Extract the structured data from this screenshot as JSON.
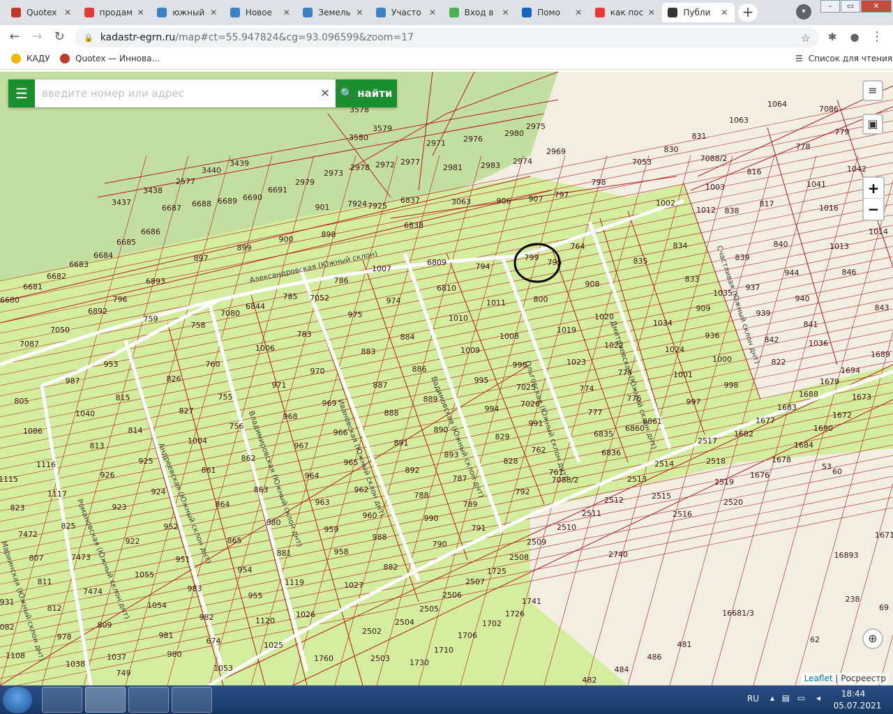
{
  "browser": {
    "tabs": [
      {
        "title": "Quotex",
        "color": "#c0392b",
        "active": false
      },
      {
        "title": "продам",
        "color": "#e53935",
        "active": false
      },
      {
        "title": "южный",
        "color": "#3b82c4",
        "active": false
      },
      {
        "title": "Новое",
        "color": "#3b82c4",
        "active": false
      },
      {
        "title": "Земель",
        "color": "#3b82c4",
        "active": false
      },
      {
        "title": "Участо",
        "color": "#3b82c4",
        "active": false
      },
      {
        "title": "Вход в",
        "color": "#4caf50",
        "active": false
      },
      {
        "title": "Помо",
        "color": "#1565c0",
        "active": false
      },
      {
        "title": "как пос",
        "color": "#e53935",
        "active": false
      },
      {
        "title": "Публи",
        "color": "#333333",
        "active": true
      }
    ],
    "url_host": "kadastr-egrn.ru",
    "url_path": "/map#ct=55.947824&cg=93.096599&zoom=17",
    "bookmarks": [
      {
        "label": "КАДУ",
        "color": "#f2b600"
      },
      {
        "label": "Quotex — Иннова...",
        "color": "#c0392b"
      }
    ],
    "reading_list": "Список для чтения"
  },
  "map": {
    "search_placeholder": "введите номер или адрес",
    "find_label": "найти",
    "zoom_in": "+",
    "zoom_out": "−",
    "attribution_leaflet": "Leaflet",
    "attribution_separator": " | ",
    "attribution_source": "Росреестр",
    "colors": {
      "background": "#f2eee2",
      "forest": "#c3dfa0",
      "plot_fill": "#d3ec9e",
      "boundary": "#b51a1a",
      "road": "#ffffff",
      "highlight_circle": "#000000",
      "search_green": "#1b8f2e"
    },
    "streets": [
      "Александровская (Южный склон)",
      "Дмитриевская (Южный склон днт)",
      "Ольговская (Южный склон днт)",
      "Вадимовская (Южный склон днт)",
      "Ивановская (Южный склон днт)",
      "Владимировская (Южный склон днт)",
      "Андреевская (Южный склон днт)",
      "Романовская (Южный склон днт)",
      "Мариинская (Южный склон днт)",
      "Счастливая (Южный склон днт)"
    ],
    "highlighted_plot": "799",
    "plots": [
      {
        "n": "3578"
      },
      {
        "n": "3579"
      },
      {
        "n": "3580"
      },
      {
        "n": "2971"
      },
      {
        "n": "2976"
      },
      {
        "n": "2980"
      },
      {
        "n": "2975"
      },
      {
        "n": "3440"
      },
      {
        "n": "3439"
      },
      {
        "n": "2577"
      },
      {
        "n": "3438"
      },
      {
        "n": "3437"
      },
      {
        "n": "2979"
      },
      {
        "n": "2973"
      },
      {
        "n": "2978"
      },
      {
        "n": "2972"
      },
      {
        "n": "2977"
      },
      {
        "n": "2981"
      },
      {
        "n": "2983"
      },
      {
        "n": "2974"
      },
      {
        "n": "2969"
      },
      {
        "n": "6687"
      },
      {
        "n": "6688"
      },
      {
        "n": "6689"
      },
      {
        "n": "6690"
      },
      {
        "n": "6691"
      },
      {
        "n": "6686"
      },
      {
        "n": "6685"
      },
      {
        "n": "6684"
      },
      {
        "n": "6683"
      },
      {
        "n": "6682"
      },
      {
        "n": "6681"
      },
      {
        "n": "6680"
      },
      {
        "n": "901"
      },
      {
        "n": "7924"
      },
      {
        "n": "7925"
      },
      {
        "n": "6837"
      },
      {
        "n": "6838"
      },
      {
        "n": "3063"
      },
      {
        "n": "906"
      },
      {
        "n": "907"
      },
      {
        "n": "797"
      },
      {
        "n": "798"
      },
      {
        "n": "7053"
      },
      {
        "n": "830"
      },
      {
        "n": "831"
      },
      {
        "n": "1063"
      },
      {
        "n": "1064"
      },
      {
        "n": "7086"
      },
      {
        "n": "7088/2"
      },
      {
        "n": "779"
      },
      {
        "n": "899"
      },
      {
        "n": "900"
      },
      {
        "n": "898"
      },
      {
        "n": "897"
      },
      {
        "n": "6893"
      },
      {
        "n": "6892"
      },
      {
        "n": "796"
      },
      {
        "n": "7050"
      },
      {
        "n": "7087"
      },
      {
        "n": "759"
      },
      {
        "n": "758"
      },
      {
        "n": "7080"
      },
      {
        "n": "6844"
      },
      {
        "n": "785"
      },
      {
        "n": "7052"
      },
      {
        "n": "786"
      },
      {
        "n": "1007"
      },
      {
        "n": "6809"
      },
      {
        "n": "794"
      },
      {
        "n": "799"
      },
      {
        "n": "795"
      },
      {
        "n": "764"
      },
      {
        "n": "1012"
      },
      {
        "n": "1002"
      },
      {
        "n": "834"
      },
      {
        "n": "835"
      },
      {
        "n": "833"
      },
      {
        "n": "1035"
      },
      {
        "n": "909"
      },
      {
        "n": "1034"
      },
      {
        "n": "936"
      },
      {
        "n": "1024"
      },
      {
        "n": "1000"
      },
      {
        "n": "1001"
      },
      {
        "n": "998"
      },
      {
        "n": "997"
      },
      {
        "n": "1003"
      },
      {
        "n": "816"
      },
      {
        "n": "838"
      },
      {
        "n": "817"
      },
      {
        "n": "839"
      },
      {
        "n": "840"
      },
      {
        "n": "937"
      },
      {
        "n": "944"
      },
      {
        "n": "939"
      },
      {
        "n": "940"
      },
      {
        "n": "842"
      },
      {
        "n": "841"
      },
      {
        "n": "822"
      },
      {
        "n": "1036"
      },
      {
        "n": "778"
      },
      {
        "n": "1041"
      },
      {
        "n": "1042"
      },
      {
        "n": "1016"
      },
      {
        "n": "1013"
      },
      {
        "n": "1014"
      },
      {
        "n": "846"
      },
      {
        "n": "843"
      },
      {
        "n": "6810"
      },
      {
        "n": "1011"
      },
      {
        "n": "1010"
      },
      {
        "n": "1008"
      },
      {
        "n": "1009"
      },
      {
        "n": "996"
      },
      {
        "n": "995"
      },
      {
        "n": "7025"
      },
      {
        "n": "7026"
      },
      {
        "n": "994"
      },
      {
        "n": "991"
      },
      {
        "n": "829"
      },
      {
        "n": "828"
      },
      {
        "n": "792"
      },
      {
        "n": "762"
      },
      {
        "n": "761"
      },
      {
        "n": "7088/2"
      },
      {
        "n": "800"
      },
      {
        "n": "908"
      },
      {
        "n": "1020"
      },
      {
        "n": "1019"
      },
      {
        "n": "1022"
      },
      {
        "n": "1023"
      },
      {
        "n": "775"
      },
      {
        "n": "774"
      },
      {
        "n": "776"
      },
      {
        "n": "777"
      },
      {
        "n": "6835"
      },
      {
        "n": "6860"
      },
      {
        "n": "6861"
      },
      {
        "n": "6836"
      },
      {
        "n": "974"
      },
      {
        "n": "975"
      },
      {
        "n": "884"
      },
      {
        "n": "883"
      },
      {
        "n": "886"
      },
      {
        "n": "887"
      },
      {
        "n": "889"
      },
      {
        "n": "888"
      },
      {
        "n": "890"
      },
      {
        "n": "891"
      },
      {
        "n": "893"
      },
      {
        "n": "892"
      },
      {
        "n": "787"
      },
      {
        "n": "788"
      },
      {
        "n": "789"
      },
      {
        "n": "990"
      },
      {
        "n": "791"
      },
      {
        "n": "790"
      },
      {
        "n": "1006"
      },
      {
        "n": "783"
      },
      {
        "n": "970"
      },
      {
        "n": "971"
      },
      {
        "n": "969"
      },
      {
        "n": "968"
      },
      {
        "n": "966"
      },
      {
        "n": "967"
      },
      {
        "n": "965"
      },
      {
        "n": "964"
      },
      {
        "n": "962"
      },
      {
        "n": "963"
      },
      {
        "n": "960"
      },
      {
        "n": "959"
      },
      {
        "n": "988"
      },
      {
        "n": "958"
      },
      {
        "n": "882"
      },
      {
        "n": "1027"
      },
      {
        "n": "760"
      },
      {
        "n": "826"
      },
      {
        "n": "755"
      },
      {
        "n": "827"
      },
      {
        "n": "756"
      },
      {
        "n": "1004"
      },
      {
        "n": "862"
      },
      {
        "n": "861"
      },
      {
        "n": "863"
      },
      {
        "n": "864"
      },
      {
        "n": "880"
      },
      {
        "n": "865"
      },
      {
        "n": "881"
      },
      {
        "n": "954"
      },
      {
        "n": "1119"
      },
      {
        "n": "955"
      },
      {
        "n": "1120"
      },
      {
        "n": "1026"
      },
      {
        "n": "1025"
      },
      {
        "n": "953"
      },
      {
        "n": "987"
      },
      {
        "n": "815"
      },
      {
        "n": "1040"
      },
      {
        "n": "814"
      },
      {
        "n": "813"
      },
      {
        "n": "925"
      },
      {
        "n": "926"
      },
      {
        "n": "924"
      },
      {
        "n": "923"
      },
      {
        "n": "952"
      },
      {
        "n": "922"
      },
      {
        "n": "951"
      },
      {
        "n": "1055"
      },
      {
        "n": "983"
      },
      {
        "n": "1054"
      },
      {
        "n": "982"
      },
      {
        "n": "981"
      },
      {
        "n": "674"
      },
      {
        "n": "980"
      },
      {
        "n": "1053"
      },
      {
        "n": "805"
      },
      {
        "n": "1086"
      },
      {
        "n": "1116"
      },
      {
        "n": "1115"
      },
      {
        "n": "1117"
      },
      {
        "n": "823"
      },
      {
        "n": "825"
      },
      {
        "n": "7472"
      },
      {
        "n": "7473"
      },
      {
        "n": "807"
      },
      {
        "n": "7474"
      },
      {
        "n": "811"
      },
      {
        "n": "809"
      },
      {
        "n": "812"
      },
      {
        "n": "1037"
      },
      {
        "n": "978"
      },
      {
        "n": "1108"
      },
      {
        "n": "1038"
      },
      {
        "n": "749"
      },
      {
        "n": "931"
      },
      {
        "n": "082"
      },
      {
        "n": "2517"
      },
      {
        "n": "2518"
      },
      {
        "n": "2519"
      },
      {
        "n": "2520"
      },
      {
        "n": "1682"
      },
      {
        "n": "1677"
      },
      {
        "n": "1683"
      },
      {
        "n": "1688"
      },
      {
        "n": "1678"
      },
      {
        "n": "1684"
      },
      {
        "n": "1676"
      },
      {
        "n": "1690"
      },
      {
        "n": "1679"
      },
      {
        "n": "1694"
      },
      {
        "n": "1672"
      },
      {
        "n": "1673"
      },
      {
        "n": "1689"
      },
      {
        "n": "2514"
      },
      {
        "n": "2513"
      },
      {
        "n": "2515"
      },
      {
        "n": "2516"
      },
      {
        "n": "2512"
      },
      {
        "n": "2511"
      },
      {
        "n": "2510"
      },
      {
        "n": "2509"
      },
      {
        "n": "2740"
      },
      {
        "n": "2508"
      },
      {
        "n": "1725"
      },
      {
        "n": "2507"
      },
      {
        "n": "2506"
      },
      {
        "n": "2505"
      },
      {
        "n": "2504"
      },
      {
        "n": "2502"
      },
      {
        "n": "1741"
      },
      {
        "n": "1726"
      },
      {
        "n": "1702"
      },
      {
        "n": "1706"
      },
      {
        "n": "1710"
      },
      {
        "n": "1730"
      },
      {
        "n": "2503"
      },
      {
        "n": "1760"
      },
      {
        "n": "53"
      },
      {
        "n": "60"
      },
      {
        "n": "16893"
      },
      {
        "n": "1671"
      },
      {
        "n": "16681/3"
      },
      {
        "n": "238"
      },
      {
        "n": "69"
      },
      {
        "n": "481"
      },
      {
        "n": "486"
      },
      {
        "n": "484"
      },
      {
        "n": "482"
      },
      {
        "n": "62"
      }
    ]
  },
  "taskbar": {
    "lang": "RU",
    "time": "18:44",
    "date": "05.07.2021"
  }
}
